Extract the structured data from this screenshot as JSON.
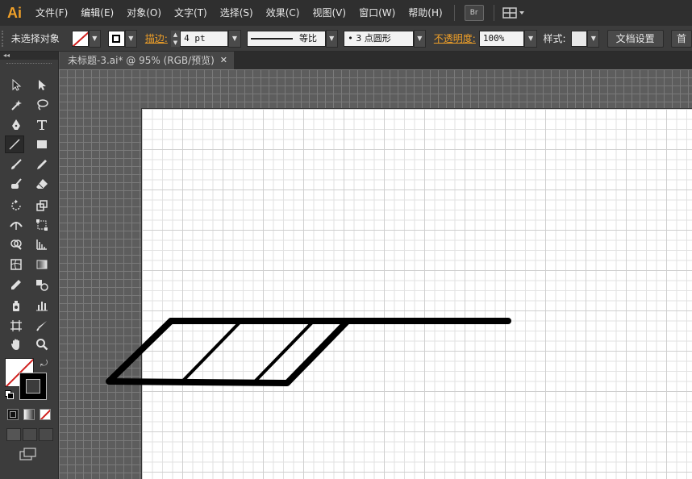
{
  "app": {
    "logo": "Ai",
    "accent": "#f0a028"
  },
  "menubar": {
    "items": [
      "文件(F)",
      "编辑(E)",
      "对象(O)",
      "文字(T)",
      "选择(S)",
      "效果(C)",
      "视图(V)",
      "窗口(W)",
      "帮助(H)"
    ],
    "bridge_label": "Br"
  },
  "control": {
    "selection_status": "未选择对象",
    "stroke_label": "描边:",
    "stroke_weight": "4 pt",
    "profile_label": "等比",
    "brush_label": "• 3 点圆形",
    "opacity_label": "不透明度:",
    "opacity_value": "100%",
    "style_label": "样式:",
    "doc_setup": "文档设置",
    "prefs": "首"
  },
  "document": {
    "tab_title": "未标题-3.ai* @ 95% (RGB/预览)",
    "close_glyph": "✕"
  },
  "tools": [
    "selection-tool",
    "direct-selection-tool",
    "magic-wand-tool",
    "lasso-tool",
    "pen-tool",
    "type-tool",
    "line-segment-tool",
    "rectangle-tool",
    "paintbrush-tool",
    "pencil-tool",
    "blob-brush-tool",
    "eraser-tool",
    "rotate-tool",
    "scale-tool",
    "width-tool",
    "free-transform-tool",
    "shape-builder-tool",
    "perspective-grid-tool",
    "mesh-tool",
    "gradient-tool",
    "eyedropper-tool",
    "blend-tool",
    "symbol-sprayer-tool",
    "column-graph-tool",
    "artboard-tool",
    "slice-tool",
    "hand-tool",
    "zoom-tool"
  ],
  "active_tool": "line-segment-tool"
}
